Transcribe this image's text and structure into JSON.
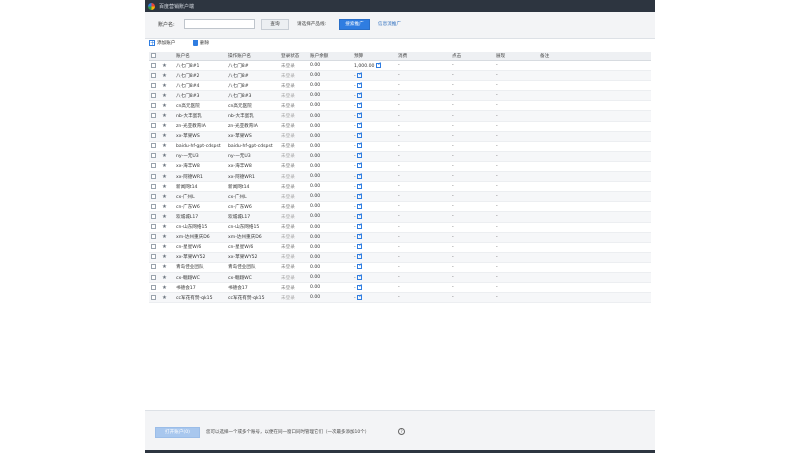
{
  "window": {
    "title": "百度营销账户端"
  },
  "toolbar": {
    "account_label": "账户名:",
    "search_placeholder": "",
    "query_button": "查询",
    "hint": "请选择产品线:",
    "search_ads_button": "搜索推广",
    "info_flow_link": "信息流推广"
  },
  "actions": {
    "add_label": "添加账户",
    "delete_label": "删除"
  },
  "table": {
    "headers": [
      "账户名",
      "操作账户名",
      "登录状态",
      "账户余额",
      "预算",
      "消费",
      "点击",
      "展现",
      "备注"
    ],
    "rows": [
      {
        "name": "八七门8#1",
        "op": "八七门8#",
        "status": "未登录",
        "balance": "0.00",
        "budget": "1,000.00",
        "cost": "-",
        "clicks": "-",
        "impr": "-"
      },
      {
        "name": "八七门8#2",
        "op": "八七门8#",
        "status": "未登录",
        "balance": "0.00",
        "budget": "-",
        "cost": "-",
        "clicks": "-",
        "impr": "-"
      },
      {
        "name": "八七门8#4",
        "op": "八七门8#",
        "status": "未登录",
        "balance": "0.00",
        "budget": "-",
        "cost": "-",
        "clicks": "-",
        "impr": "-"
      },
      {
        "name": "八七门8#3",
        "op": "八七门8#3",
        "status": "未登录",
        "balance": "0.00",
        "budget": "-",
        "cost": "-",
        "clicks": "-",
        "impr": "-"
      },
      {
        "name": "cn高元医院",
        "op": "cn高元医院",
        "status": "未登录",
        "balance": "0.00",
        "budget": "-",
        "cost": "-",
        "clicks": "-",
        "impr": "-"
      },
      {
        "name": "nb-大丰蛋乳",
        "op": "nb-大丰蛋乳",
        "status": "未登录",
        "balance": "0.00",
        "budget": "-",
        "cost": "-",
        "clicks": "-",
        "impr": "-"
      },
      {
        "name": "zn-光亚教育IA",
        "op": "zn-光亚教育IA",
        "status": "未登录",
        "balance": "0.00",
        "budget": "-",
        "cost": "-",
        "clicks": "-",
        "impr": "-"
      },
      {
        "name": "xx-苹果WS",
        "op": "xx-苹果WS",
        "status": "未登录",
        "balance": "0.00",
        "budget": "-",
        "cost": "-",
        "clicks": "-",
        "impr": "-"
      },
      {
        "name": "baidu-hf-gpt-cdspst",
        "op": "baidu-hf-gpt-cdspst",
        "status": "未登录",
        "balance": "0.00",
        "budget": "-",
        "cost": "-",
        "clicks": "-",
        "impr": "-"
      },
      {
        "name": "ny-一无U3",
        "op": "ny-一无U3",
        "status": "未登录",
        "balance": "0.00",
        "budget": "-",
        "cost": "-",
        "clicks": "-",
        "impr": "-"
      },
      {
        "name": "xx-海丰W8",
        "op": "xx-海丰W8",
        "status": "未登录",
        "balance": "0.00",
        "budget": "-",
        "cost": "-",
        "clicks": "-",
        "impr": "-"
      },
      {
        "name": "xx-阿德WR1",
        "op": "xx-阿德WR1",
        "status": "未登录",
        "balance": "0.00",
        "budget": "-",
        "cost": "-",
        "clicks": "-",
        "impr": "-"
      },
      {
        "name": "新闻网t14",
        "op": "新闻网t14",
        "status": "未登录",
        "balance": "0.00",
        "budget": "-",
        "cost": "-",
        "clicks": "-",
        "impr": "-"
      },
      {
        "name": "cx-广州L",
        "op": "cx-广州L",
        "status": "未登录",
        "balance": "0.00",
        "budget": "-",
        "cost": "-",
        "clicks": "-",
        "impr": "-"
      },
      {
        "name": "cn-广东W6",
        "op": "cn-广东W6",
        "status": "未登录",
        "balance": "0.00",
        "budget": "-",
        "cost": "-",
        "clicks": "-",
        "impr": "-"
      },
      {
        "name": "欢城城L17",
        "op": "欢城城L17",
        "status": "未登录",
        "balance": "0.00",
        "budget": "-",
        "cost": "-",
        "clicks": "-",
        "impr": "-"
      },
      {
        "name": "cn-山东网络15",
        "op": "cn-山东网络15",
        "status": "未登录",
        "balance": "0.00",
        "budget": "-",
        "cost": "-",
        "clicks": "-",
        "impr": "-"
      },
      {
        "name": "xm-达州重庆D6",
        "op": "xm-达州重庆D6",
        "status": "未登录",
        "balance": "0.00",
        "budget": "-",
        "cost": "-",
        "clicks": "-",
        "impr": "-"
      },
      {
        "name": "cn-星星W/6",
        "op": "cn-星星W/6",
        "status": "未登录",
        "balance": "0.00",
        "budget": "-",
        "cost": "-",
        "clicks": "-",
        "impr": "-"
      },
      {
        "name": "xx-苹果WY52",
        "op": "xx-苹果WY52",
        "status": "未登录",
        "balance": "0.00",
        "budget": "-",
        "cost": "-",
        "clicks": "-",
        "impr": "-"
      },
      {
        "name": "青岛佳业团队",
        "op": "青岛佳业团队",
        "status": "未登录",
        "balance": "0.00",
        "budget": "-",
        "cost": "-",
        "clicks": "-",
        "impr": "-"
      },
      {
        "name": "cx-翱翔WC",
        "op": "cx-翱翔WC",
        "status": "未登录",
        "balance": "0.00",
        "budget": "-",
        "cost": "-",
        "clicks": "-",
        "impr": "-"
      },
      {
        "name": "书德会17",
        "op": "书德会17",
        "status": "未登录",
        "balance": "0.00",
        "budget": "-",
        "cost": "-",
        "clicks": "-",
        "impr": "-"
      },
      {
        "name": "cc军花有赞-qk15",
        "op": "cc军花有赞-qk15",
        "status": "未登录",
        "balance": "0.00",
        "budget": "-",
        "cost": "-",
        "clicks": "-",
        "impr": "-"
      }
    ]
  },
  "bottom": {
    "open_button": "打开账户(0)",
    "tip": "您可以选择一个或多个账号，以便在同一窗口同时管理它们（一次最多添加10个）"
  },
  "colors": {
    "accent": "#2f7de1",
    "titlebar": "#2d3540",
    "toolbar_bg": "#f3f4f6"
  }
}
